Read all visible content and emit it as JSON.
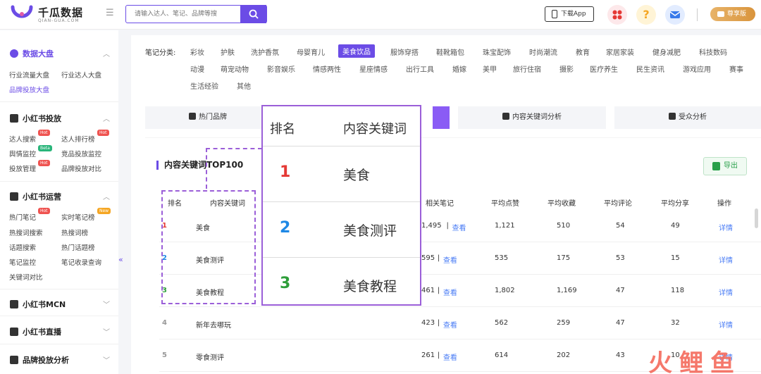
{
  "header": {
    "brand": "千瓜数据",
    "brand_sub": "QIAN-GUA.COM",
    "search_placeholder": "请输入达人、笔记、品牌等搜",
    "download_label": "下载App",
    "vip_label": "尊享版",
    "help_glyph": "?",
    "menu_glyph": "☰"
  },
  "sidebar": {
    "sections": [
      {
        "title": "数据大盘",
        "links": [
          "行业流量大盘",
          "行业达人大盘",
          "品牌投放大盘"
        ]
      },
      {
        "title": "小红书投放",
        "links": [
          "达人搜索",
          "达人排行榜",
          "舆情监控",
          "竞品投放监控",
          "投放管理",
          "品牌投放对比"
        ]
      },
      {
        "title": "小红书运营",
        "links": [
          "热门笔记",
          "实时笔记榜",
          "热搜词搜索",
          "热搜词榜",
          "话题搜索",
          "热门话题榜",
          "笔记监控",
          "笔记收录查询",
          "关键词对比"
        ]
      },
      {
        "title": "小红书MCN"
      },
      {
        "title": "小红书直播"
      },
      {
        "title": "品牌投放分析"
      }
    ],
    "badges": {
      "hot": "Hot",
      "beta": "Beta",
      "new": "New"
    },
    "chevron_up": "︿",
    "chevron_down": "﹀",
    "collapse": "«"
  },
  "categories": {
    "label": "笔记分类:",
    "items": [
      "彩妆",
      "护肤",
      "洗护香氛",
      "母婴育儿",
      "美食饮品",
      "服饰穿搭",
      "鞋靴箱包",
      "珠宝配饰",
      "时尚潮流",
      "教育",
      "家居家装",
      "健身减肥",
      "科技数码",
      "动漫",
      "萌宠动物",
      "影音娱乐",
      "情感两性",
      "星座情感",
      "出行工具",
      "婚嫁",
      "美甲",
      "旅行住宿",
      "摄影",
      "医疗养生",
      "民生资讯",
      "游戏应用",
      "赛事",
      "生活经验",
      "其他"
    ],
    "active": "美食饮品"
  },
  "tabs": [
    "热门品牌",
    "内容关键词分析",
    "受众分析"
  ],
  "section_title": "内容关键词TOP100",
  "export_label": "导出",
  "table": {
    "headers": [
      "排名",
      "内容关键词",
      "相关笔记",
      "平均点赞",
      "平均收藏",
      "平均评论",
      "平均分享",
      "操作"
    ],
    "view_label": "查看",
    "detail_label": "详情",
    "rows": [
      {
        "rank": "1",
        "keyword": "美食",
        "notes": "1,495",
        "likes": "1,121",
        "favs": "510",
        "comments": "54",
        "shares": "49"
      },
      {
        "rank": "2",
        "keyword": "美食测评",
        "notes": "595",
        "likes": "535",
        "favs": "175",
        "comments": "53",
        "shares": "15"
      },
      {
        "rank": "3",
        "keyword": "美食教程",
        "notes": "461",
        "likes": "1,802",
        "favs": "1,169",
        "comments": "47",
        "shares": "118"
      },
      {
        "rank": "4",
        "keyword": "新年去哪玩",
        "notes": "423",
        "likes": "562",
        "favs": "259",
        "comments": "47",
        "shares": "32"
      },
      {
        "rank": "5",
        "keyword": "零食测评",
        "notes": "261",
        "likes": "614",
        "favs": "202",
        "comments": "43",
        "shares": "10"
      }
    ],
    "rank_colors": [
      "#e53935",
      "#1e88e5",
      "#2e9e3a",
      "#999999",
      "#999999"
    ]
  },
  "zoom": {
    "headers": [
      "排名",
      "内容关键词"
    ],
    "rows": [
      {
        "rank": "1",
        "keyword": "美食"
      },
      {
        "rank": "2",
        "keyword": "美食测评"
      },
      {
        "rank": "3",
        "keyword": "美食教程"
      }
    ]
  },
  "watermark": [
    "火",
    "鲤",
    "鱼"
  ]
}
